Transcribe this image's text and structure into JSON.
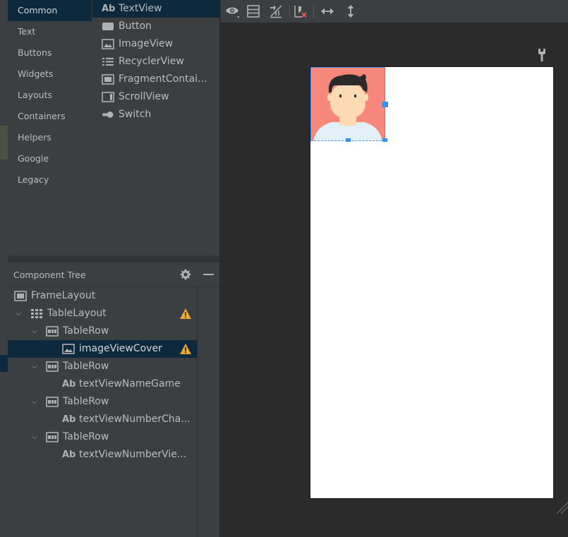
{
  "palette": {
    "categories": [
      {
        "label": "Common",
        "selected": true
      },
      {
        "label": "Text",
        "selected": false
      },
      {
        "label": "Buttons",
        "selected": false
      },
      {
        "label": "Widgets",
        "selected": false
      },
      {
        "label": "Layouts",
        "selected": false
      },
      {
        "label": "Containers",
        "selected": false
      },
      {
        "label": "Helpers",
        "selected": false
      },
      {
        "label": "Google",
        "selected": false
      },
      {
        "label": "Legacy",
        "selected": false
      }
    ],
    "widgets": [
      {
        "label": "TextView",
        "icon": "text-ab-icon",
        "selected": true
      },
      {
        "label": "Button",
        "icon": "button-icon",
        "selected": false
      },
      {
        "label": "ImageView",
        "icon": "image-icon",
        "selected": false
      },
      {
        "label": "RecyclerView",
        "icon": "list-icon",
        "selected": false
      },
      {
        "label": "FragmentContai...",
        "icon": "fragment-icon",
        "selected": false
      },
      {
        "label": "ScrollView",
        "icon": "scrollview-icon",
        "selected": false
      },
      {
        "label": "Switch",
        "icon": "switch-icon",
        "selected": false
      }
    ]
  },
  "component_tree": {
    "title": "Component Tree",
    "nodes": [
      {
        "label": "FrameLayout",
        "icon": "frame-layout-icon",
        "expanded": null,
        "warning": false,
        "selected": false
      },
      {
        "label": "TableLayout",
        "icon": "table-layout-icon",
        "expanded": true,
        "warning": true,
        "selected": false
      },
      {
        "label": "TableRow",
        "icon": "table-row-icon",
        "expanded": true,
        "warning": false,
        "selected": false
      },
      {
        "label": "imageViewCover",
        "icon": "image-icon",
        "expanded": null,
        "warning": true,
        "selected": true
      },
      {
        "label": "TableRow",
        "icon": "table-row-icon",
        "expanded": true,
        "warning": false,
        "selected": false
      },
      {
        "label": "textViewNameGame",
        "icon": "text-ab-icon",
        "expanded": null,
        "warning": false,
        "selected": false
      },
      {
        "label": "TableRow",
        "icon": "table-row-icon",
        "expanded": true,
        "warning": false,
        "selected": false
      },
      {
        "label": "textViewNumberCha...",
        "icon": "text-ab-icon",
        "expanded": null,
        "warning": false,
        "selected": false
      },
      {
        "label": "TableRow",
        "icon": "table-row-icon",
        "expanded": true,
        "warning": false,
        "selected": false
      },
      {
        "label": "textViewNumberVie...",
        "icon": "text-ab-icon",
        "expanded": null,
        "warning": false,
        "selected": false
      }
    ]
  },
  "toolbar": {
    "items": [
      "eye-icon",
      "blueprint-icon",
      "constraints-icon",
      "clear-constraints-icon",
      "horizontal-arrows-icon",
      "vertical-arrows-icon"
    ]
  },
  "design": {
    "image": "avatar-image",
    "image_background": "#f7877b"
  },
  "icons": {
    "ab_glyph": "Ab"
  },
  "colors": {
    "selection": "#0d293e",
    "warning": "#f0a732",
    "handle": "#2f8ff2",
    "panel": "#3c3f41",
    "canvas": "#2b2b2b"
  }
}
